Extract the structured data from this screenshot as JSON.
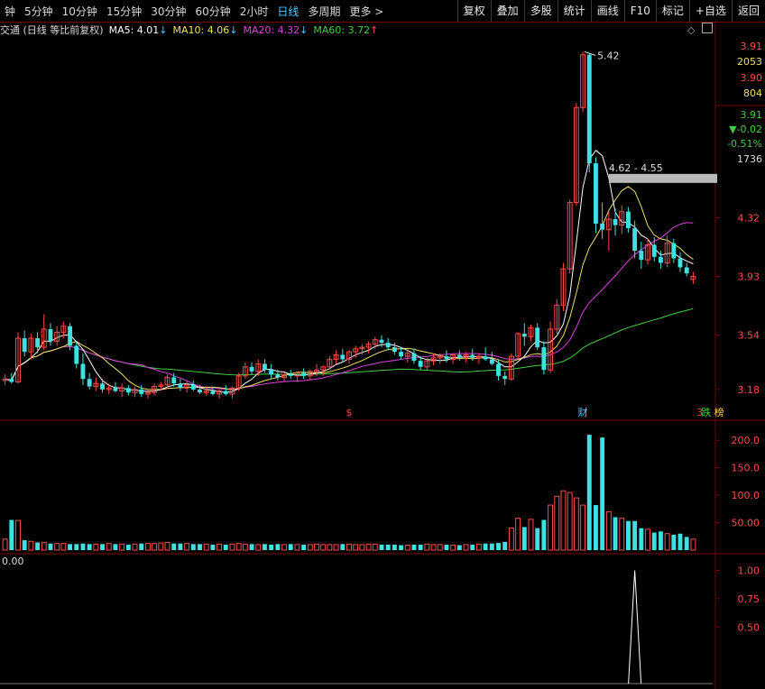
{
  "toolbar": {
    "periods": [
      "钟",
      "5分钟",
      "10分钟",
      "15分钟",
      "30分钟",
      "60分钟",
      "2小时",
      "日线",
      "多周期",
      "更多 >"
    ],
    "active": "日线",
    "actions": [
      "复权",
      "叠加",
      "多股",
      "统计",
      "画线",
      "F10",
      "标记",
      "+自选",
      "返回"
    ]
  },
  "legend": {
    "title": "交通 (日线 等比前复权)",
    "ma5": "MA5: 4.01",
    "ma5_arrow": "↓",
    "ma5_color": "#ffffff",
    "ma10": "MA10: 4.06",
    "ma10_arrow": "↓",
    "ma10_color": "#f0e060",
    "ma20": "MA20: 4.32",
    "ma20_arrow": "↓",
    "ma20_color": "#e040e0",
    "ma60": "MA60: 3.72",
    "ma60_arrow": "↑",
    "ma60_color": "#40d040"
  },
  "quote_panel": {
    "price": "3.91",
    "vol": "2053",
    "price2": "3.90",
    "vol2": "804",
    "last": "3.91",
    "change": "▼-0.02",
    "pct": "-0.51%",
    "amount": "1736"
  },
  "price_axis": [
    "4.32",
    "3.93",
    "3.54",
    "3.18"
  ],
  "annotations": {
    "high_label": "5.42",
    "range_label": "4.62 - 4.55",
    "markers": [
      {
        "text": "$",
        "color": "#ff4040",
        "day": 53
      },
      {
        "text": "财",
        "color": "#4ec9ff",
        "day": 89
      },
      {
        "text": "3",
        "color": "#ff4040",
        "day": 107
      },
      {
        "text": "跌",
        "color": "#40d040",
        "day": 108
      },
      {
        "text": "榜",
        "color": "#ffd040",
        "day": 110
      }
    ]
  },
  "volume_axis": [
    "200.0",
    "150.0",
    "100.0",
    "50.00"
  ],
  "indicator": {
    "value_label": "0.00",
    "axis": [
      "1.00",
      "0.75",
      "0.50"
    ]
  },
  "chart_data": {
    "type": "candlestick",
    "ohlc": [
      [
        3.24,
        3.28,
        3.21,
        3.25
      ],
      [
        3.25,
        3.29,
        3.22,
        3.23
      ],
      [
        3.23,
        3.56,
        3.22,
        3.52
      ],
      [
        3.52,
        3.57,
        3.4,
        3.43
      ],
      [
        3.43,
        3.55,
        3.38,
        3.52
      ],
      [
        3.52,
        3.56,
        3.42,
        3.46
      ],
      [
        3.46,
        3.68,
        3.44,
        3.58
      ],
      [
        3.58,
        3.62,
        3.47,
        3.5
      ],
      [
        3.5,
        3.6,
        3.47,
        3.56
      ],
      [
        3.56,
        3.63,
        3.52,
        3.6
      ],
      [
        3.6,
        3.62,
        3.44,
        3.47
      ],
      [
        3.47,
        3.5,
        3.32,
        3.35
      ],
      [
        3.35,
        3.42,
        3.21,
        3.25
      ],
      [
        3.25,
        3.29,
        3.18,
        3.2
      ],
      [
        3.2,
        3.26,
        3.17,
        3.22
      ],
      [
        3.22,
        3.25,
        3.16,
        3.18
      ],
      [
        3.18,
        3.22,
        3.15,
        3.19
      ],
      [
        3.19,
        3.23,
        3.16,
        3.17
      ],
      [
        3.17,
        3.22,
        3.13,
        3.19
      ],
      [
        3.19,
        3.21,
        3.14,
        3.16
      ],
      [
        3.16,
        3.2,
        3.13,
        3.18
      ],
      [
        3.18,
        3.21,
        3.13,
        3.15
      ],
      [
        3.15,
        3.18,
        3.12,
        3.16
      ],
      [
        3.16,
        3.22,
        3.14,
        3.2
      ],
      [
        3.2,
        3.23,
        3.17,
        3.21
      ],
      [
        3.21,
        3.28,
        3.19,
        3.26
      ],
      [
        3.26,
        3.29,
        3.2,
        3.22
      ],
      [
        3.22,
        3.25,
        3.17,
        3.19
      ],
      [
        3.19,
        3.24,
        3.16,
        3.21
      ],
      [
        3.21,
        3.24,
        3.17,
        3.18
      ],
      [
        3.18,
        3.21,
        3.15,
        3.16
      ],
      [
        3.16,
        3.19,
        3.14,
        3.17
      ],
      [
        3.17,
        3.2,
        3.14,
        3.15
      ],
      [
        3.15,
        3.18,
        3.12,
        3.17
      ],
      [
        3.17,
        3.21,
        3.14,
        3.15
      ],
      [
        3.15,
        3.2,
        3.12,
        3.19
      ],
      [
        3.19,
        3.29,
        3.17,
        3.27
      ],
      [
        3.27,
        3.36,
        3.25,
        3.33
      ],
      [
        3.33,
        3.36,
        3.28,
        3.3
      ],
      [
        3.3,
        3.38,
        3.27,
        3.35
      ],
      [
        3.35,
        3.38,
        3.29,
        3.31
      ],
      [
        3.31,
        3.35,
        3.25,
        3.28
      ],
      [
        3.28,
        3.31,
        3.24,
        3.26
      ],
      [
        3.26,
        3.29,
        3.23,
        3.28
      ],
      [
        3.28,
        3.31,
        3.25,
        3.27
      ],
      [
        3.27,
        3.3,
        3.23,
        3.29
      ],
      [
        3.29,
        3.32,
        3.25,
        3.27
      ],
      [
        3.27,
        3.31,
        3.24,
        3.3
      ],
      [
        3.3,
        3.35,
        3.27,
        3.31
      ],
      [
        3.31,
        3.34,
        3.27,
        3.33
      ],
      [
        3.33,
        3.4,
        3.31,
        3.38
      ],
      [
        3.38,
        3.44,
        3.35,
        3.41
      ],
      [
        3.41,
        3.45,
        3.36,
        3.38
      ],
      [
        3.38,
        3.44,
        3.35,
        3.43
      ],
      [
        3.43,
        3.47,
        3.39,
        3.45
      ],
      [
        3.45,
        3.48,
        3.41,
        3.46
      ],
      [
        3.46,
        3.5,
        3.42,
        3.48
      ],
      [
        3.48,
        3.53,
        3.45,
        3.51
      ],
      [
        3.51,
        3.54,
        3.46,
        3.49
      ],
      [
        3.49,
        3.52,
        3.44,
        3.46
      ],
      [
        3.46,
        3.49,
        3.41,
        3.43
      ],
      [
        3.43,
        3.46,
        3.38,
        3.4
      ],
      [
        3.4,
        3.44,
        3.36,
        3.42
      ],
      [
        3.42,
        3.45,
        3.35,
        3.37
      ],
      [
        3.37,
        3.4,
        3.31,
        3.33
      ],
      [
        3.33,
        3.39,
        3.31,
        3.37
      ],
      [
        3.37,
        3.42,
        3.34,
        3.39
      ],
      [
        3.39,
        3.42,
        3.35,
        3.4
      ],
      [
        3.4,
        3.44,
        3.36,
        3.38
      ],
      [
        3.38,
        3.42,
        3.35,
        3.41
      ],
      [
        3.41,
        3.44,
        3.37,
        3.39
      ],
      [
        3.39,
        3.43,
        3.36,
        3.41
      ],
      [
        3.41,
        3.45,
        3.37,
        3.39
      ],
      [
        3.39,
        3.42,
        3.35,
        3.4
      ],
      [
        3.4,
        3.46,
        3.37,
        3.38
      ],
      [
        3.38,
        3.43,
        3.34,
        3.35
      ],
      [
        3.35,
        3.38,
        3.24,
        3.27
      ],
      [
        3.27,
        3.3,
        3.21,
        3.25
      ],
      [
        3.25,
        3.42,
        3.24,
        3.4
      ],
      [
        3.4,
        3.56,
        3.38,
        3.55
      ],
      [
        3.55,
        3.62,
        3.47,
        3.53
      ],
      [
        3.53,
        3.61,
        3.5,
        3.59
      ],
      [
        3.59,
        3.62,
        3.44,
        3.46
      ],
      [
        3.46,
        3.5,
        3.28,
        3.31
      ],
      [
        3.31,
        3.63,
        3.29,
        3.58
      ],
      [
        3.58,
        3.78,
        3.55,
        3.74
      ],
      [
        3.74,
        4.02,
        3.7,
        3.98
      ],
      [
        3.98,
        4.44,
        3.95,
        4.42
      ],
      [
        4.42,
        5.08,
        4.4,
        5.05
      ],
      [
        5.05,
        5.42,
        5.02,
        5.4
      ],
      [
        5.4,
        5.41,
        4.62,
        4.68
      ],
      [
        4.68,
        4.72,
        4.22,
        4.28
      ],
      [
        4.28,
        4.42,
        4.18,
        4.24
      ],
      [
        4.24,
        4.36,
        4.1,
        4.31
      ],
      [
        4.31,
        4.38,
        4.2,
        4.27
      ],
      [
        4.27,
        4.4,
        4.21,
        4.36
      ],
      [
        4.36,
        4.39,
        4.22,
        4.25
      ],
      [
        4.25,
        4.3,
        4.05,
        4.1
      ],
      [
        4.1,
        4.16,
        3.98,
        4.04
      ],
      [
        4.04,
        4.18,
        4.01,
        4.14
      ],
      [
        4.14,
        4.19,
        4.03,
        4.06
      ],
      [
        4.06,
        4.1,
        3.98,
        4.02
      ],
      [
        4.02,
        4.2,
        3.99,
        4.15
      ],
      [
        4.15,
        4.18,
        4.02,
        4.05
      ],
      [
        4.05,
        4.09,
        3.96,
        3.99
      ],
      [
        3.99,
        4.02,
        3.93,
        3.95
      ],
      [
        3.91,
        3.96,
        3.88,
        3.93
      ]
    ],
    "volume": [
      20,
      55,
      54,
      18,
      16,
      14,
      14,
      12,
      12,
      12,
      11,
      11,
      12,
      11,
      11,
      11,
      12,
      11,
      11,
      10,
      11,
      12,
      12,
      12,
      13,
      14,
      12,
      12,
      12,
      11,
      11,
      11,
      10,
      11,
      10,
      11,
      12,
      11,
      11,
      10,
      11,
      10,
      11,
      10,
      11,
      10,
      10,
      10,
      11,
      10,
      10,
      10,
      11,
      11,
      10,
      10,
      11,
      11,
      10,
      10,
      10,
      9,
      9,
      10,
      10,
      11,
      10,
      10,
      10,
      9,
      9,
      10,
      10,
      11,
      12,
      12,
      13,
      15,
      40,
      58,
      42,
      56,
      40,
      55,
      82,
      98,
      108,
      105,
      95,
      82,
      210,
      82,
      205,
      70,
      60,
      58,
      53,
      53,
      40,
      38,
      32,
      34,
      30,
      28,
      30,
      24,
      20
    ],
    "price_ylim": [
      3.0,
      5.5
    ],
    "volume_ylim": [
      0,
      220
    ],
    "indicator_ylim": [
      0,
      1.1
    ],
    "indicator_spike": {
      "day": 97,
      "value": 1.0
    }
  }
}
